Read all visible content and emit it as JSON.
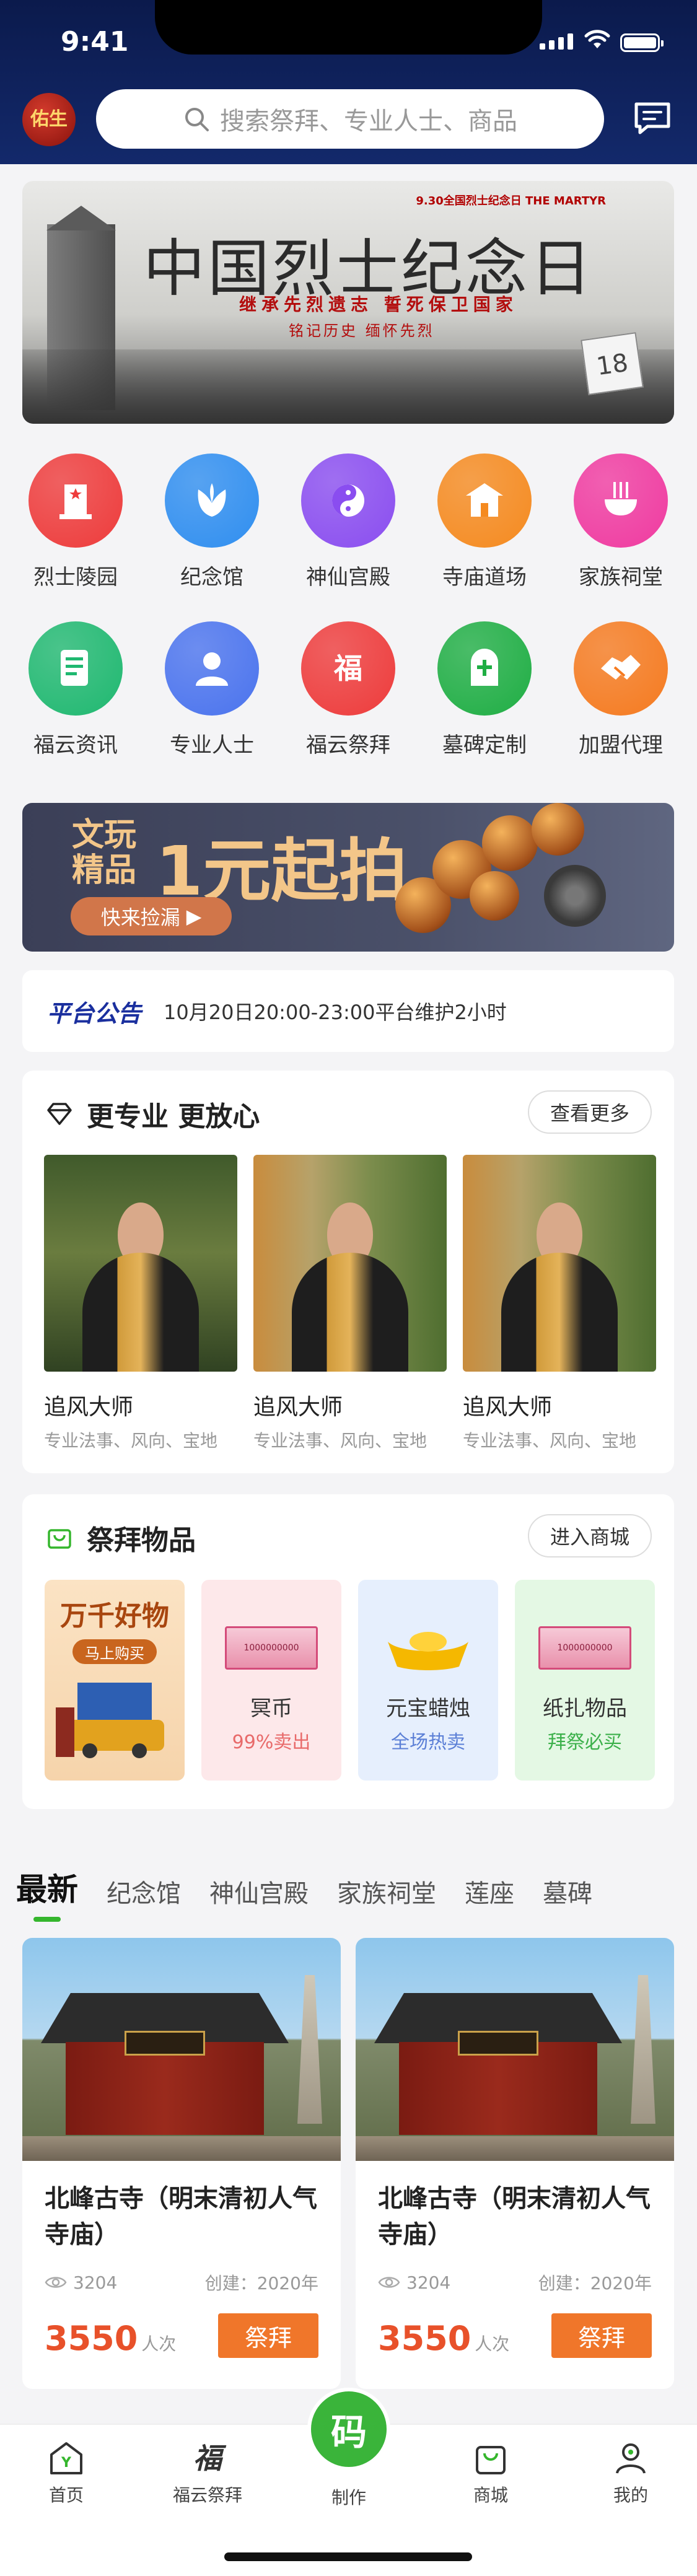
{
  "status": {
    "time": "9:41"
  },
  "header": {
    "logo_text": "佑生",
    "search_placeholder": "搜索祭拜、专业人士、商品"
  },
  "banner": {
    "tag": "9.30全国烈士纪念日 THE MARTYR",
    "title": "中国烈士纪念日",
    "line1": "继承先烈遗志 誓死保卫国家",
    "line2": "铭记历史 缅怀先烈",
    "calendar_day": "18"
  },
  "categories": [
    {
      "label": "烈士陵园",
      "icon": "memorial-icon",
      "color": "#ee3b3b"
    },
    {
      "label": "纪念馆",
      "icon": "flower-icon",
      "color": "#2f8ef0"
    },
    {
      "label": "神仙宫殿",
      "icon": "yin-yang-icon",
      "color": "#8a4df0"
    },
    {
      "label": "寺庙道场",
      "icon": "temple-icon",
      "color": "#f58a1f"
    },
    {
      "label": "家族祠堂",
      "icon": "incense-icon",
      "color": "#f03aa0"
    },
    {
      "label": "福云资讯",
      "icon": "news-icon",
      "color": "#1fb870"
    },
    {
      "label": "专业人士",
      "icon": "person-icon",
      "color": "#4a73ee"
    },
    {
      "label": "福云祭拜",
      "icon": "fu-icon",
      "color": "#ee3b3b"
    },
    {
      "label": "墓碑定制",
      "icon": "tombstone-icon",
      "color": "#1fae44"
    },
    {
      "label": "加盟代理",
      "icon": "handshake-icon",
      "color": "#f57a1f"
    }
  ],
  "ad": {
    "line1a": "文玩",
    "line1b": "精品",
    "headline": "1元起拍",
    "button": "快来捡漏"
  },
  "notice": {
    "badge": "平台公告",
    "text": "10月20日20:00-23:00平台维护2小时"
  },
  "professionals": {
    "title": "更专业 更放心",
    "more": "查看更多",
    "items": [
      {
        "name": "追风大师",
        "desc": "专业法事、风向、宝地"
      },
      {
        "name": "追风大师",
        "desc": "专业法事、风向、宝地"
      },
      {
        "name": "追风大师",
        "desc": "专业法事、风向、宝地"
      }
    ]
  },
  "goods": {
    "title": "祭拜物品",
    "more": "进入商城",
    "promo": {
      "title": "万千好物",
      "button": "马上购买"
    },
    "items": [
      {
        "name": "冥币",
        "sub": "99%卖出",
        "sub_color": "#e86a6a",
        "bg": "#fde8ea",
        "banknote": "1000000000"
      },
      {
        "name": "元宝蜡烛",
        "sub": "全场热卖",
        "sub_color": "#5b7fd6",
        "bg": "#e6effd"
      },
      {
        "name": "纸扎物品",
        "sub": "拜祭必买",
        "sub_color": "#3bb04a",
        "bg": "#e4f8e4",
        "banknote": "1000000000"
      }
    ]
  },
  "tabs": [
    "最新",
    "纪念馆",
    "神仙宫殿",
    "家族祠堂",
    "莲座",
    "墓碑"
  ],
  "temples": [
    {
      "name": "北峰古寺（明末清初人气寺庙）",
      "views": "3204",
      "created": "创建：2020年",
      "count": "3550",
      "unit": "人次",
      "button": "祭拜"
    },
    {
      "name": "北峰古寺（明末清初人气寺庙）",
      "views": "3204",
      "created": "创建：2020年",
      "count": "3550",
      "unit": "人次",
      "button": "祭拜"
    }
  ],
  "nav": {
    "home": "首页",
    "worship": "福云祭拜",
    "make": "制作",
    "make_badge": "码",
    "shop": "商城",
    "mine": "我的",
    "fu_glyph": "福",
    "home_glyph": "Y"
  },
  "colors": {
    "accent_green": "#35b62d",
    "header_bg": "#0b1a4c",
    "orange": "#f0762a",
    "notice_blue": "#1a2f9e"
  }
}
